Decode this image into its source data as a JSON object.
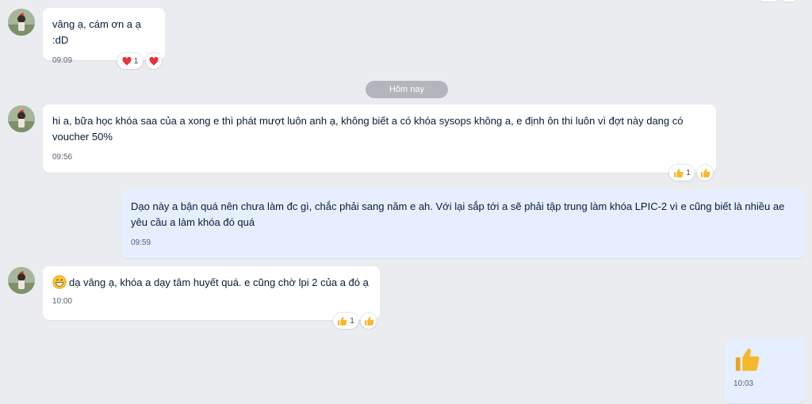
{
  "date_separator": "Hôm nay",
  "messages": [
    {
      "sender": "other",
      "text": "vâng ạ, cám ơn a ạ :dD",
      "time": "09:09",
      "reactions": {
        "count": "1",
        "icon": "heart-icon"
      }
    },
    {
      "sender": "other",
      "text": "hi a, bữa học khóa saa của a xong e thì phát mượt luôn anh ạ, không biết a có khóa sysops không a, e định ôn thi luôn vì đợt này dang có voucher 50%",
      "time": "09:56",
      "reactions": {
        "count": "1",
        "icon": "thumbs-up-icon"
      }
    },
    {
      "sender": "me",
      "text": "Dạo này a bận quá nên chưa làm đc gì, chắc phải sang năm e ah. Với lại sắp tới a sẽ phải tập trung làm khóa LPIC-2 vì e cũng biết là nhiều ae yêu cầu a làm khóa đó quá",
      "time": "09:59"
    },
    {
      "sender": "other",
      "text": "dạ vâng ạ, khóa a dạy tâm huyết quá. e cũng chờ lpi 2 của a đó ạ",
      "time": "10:00",
      "reactions": {
        "count": "1",
        "icon": "thumbs-up-icon"
      }
    },
    {
      "sender": "me",
      "sticker": "thumbs-up-icon",
      "time": "10:03"
    }
  ],
  "colors": {
    "background": "#ebecf0",
    "bubble_other": "#ffffff",
    "bubble_mine": "#e5efff",
    "heart": "#e8323c",
    "thumb": "#f5b82e"
  }
}
